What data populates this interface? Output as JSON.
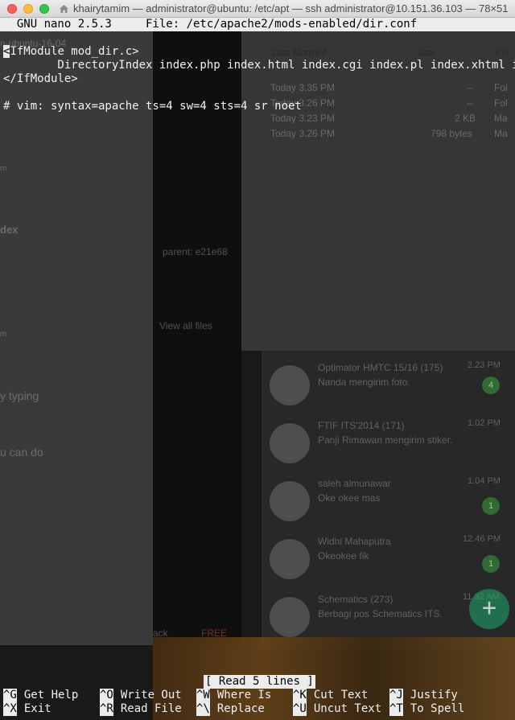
{
  "window": {
    "title": "khairytamim — administrator@ubuntu: /etc/apt — ssh administrator@10.151.36.103 — 78×51"
  },
  "nano": {
    "header": "  GNU nano 2.5.3     File: /etc/apache2/mods-enabled/dir.conf",
    "lines": [
      "<IfModule mod_dir.c>",
      "        DirectoryIndex index.php index.html index.cgi index.pl index.xhtml in$",
      "</IfModule>",
      "",
      "# vim: syntax=apache ts=4 sw=4 sts=4 sr noet"
    ],
    "status": "[ Read 5 lines ]",
    "shortcuts": [
      [
        {
          "key": "^G",
          "label": "Get Help"
        },
        {
          "key": "^O",
          "label": "Write Out"
        },
        {
          "key": "^W",
          "label": "Where Is"
        },
        {
          "key": "^K",
          "label": "Cut Text"
        },
        {
          "key": "^J",
          "label": "Justify"
        }
      ],
      [
        {
          "key": "^X",
          "label": "Exit"
        },
        {
          "key": "^R",
          "label": "Read File"
        },
        {
          "key": "^\\",
          "label": "Replace"
        },
        {
          "key": "^U",
          "label": "Uncut Text"
        },
        {
          "key": "^T",
          "label": "To Spell"
        }
      ]
    ]
  },
  "background": {
    "left_texts": [
      "n-ubuntu-16-04",
      "m",
      "dex",
      "m",
      "y typing",
      "u can do"
    ],
    "mid_texts": [
      "parent: e21e68",
      "View all files",
      "ack",
      "FREE"
    ],
    "finder_headers": [
      "Date Modified",
      "Size",
      "Kin"
    ],
    "finder_rows": [
      {
        "date": "Today 3.35 PM",
        "size": "--",
        "kind": "Fol"
      },
      {
        "date": "Today 3.26 PM",
        "size": "--",
        "kind": "Fol"
      },
      {
        "date": "Today 3.23 PM",
        "size": "2 KB",
        "kind": "Ma"
      },
      {
        "date": "Today 3.26 PM",
        "size": "798 bytes",
        "kind": "Ma"
      }
    ],
    "chats": [
      {
        "name": "Optimator HMTC 15/16 (175)",
        "msg": "Nanda mengirim foto.",
        "time": "2.23 PM",
        "badge": "4"
      },
      {
        "name": "FTIF ITS'2014 (171)",
        "msg": "Panji Rimawan mengirim stiker.",
        "time": "1.02 PM",
        "badge": ""
      },
      {
        "name": "saleh almunawar",
        "msg": "Oke okee mas",
        "time": "1.04 PM",
        "badge": "1"
      },
      {
        "name": "Widhi Mahaputra",
        "msg": "Okeokee fik",
        "time": "12.46 PM",
        "badge": "1"
      },
      {
        "name": "Schematics (273)",
        "msg": "Berbagi pos Schematics ITS.",
        "time": "11.32 AM",
        "badge": ""
      }
    ],
    "fab": "+"
  }
}
